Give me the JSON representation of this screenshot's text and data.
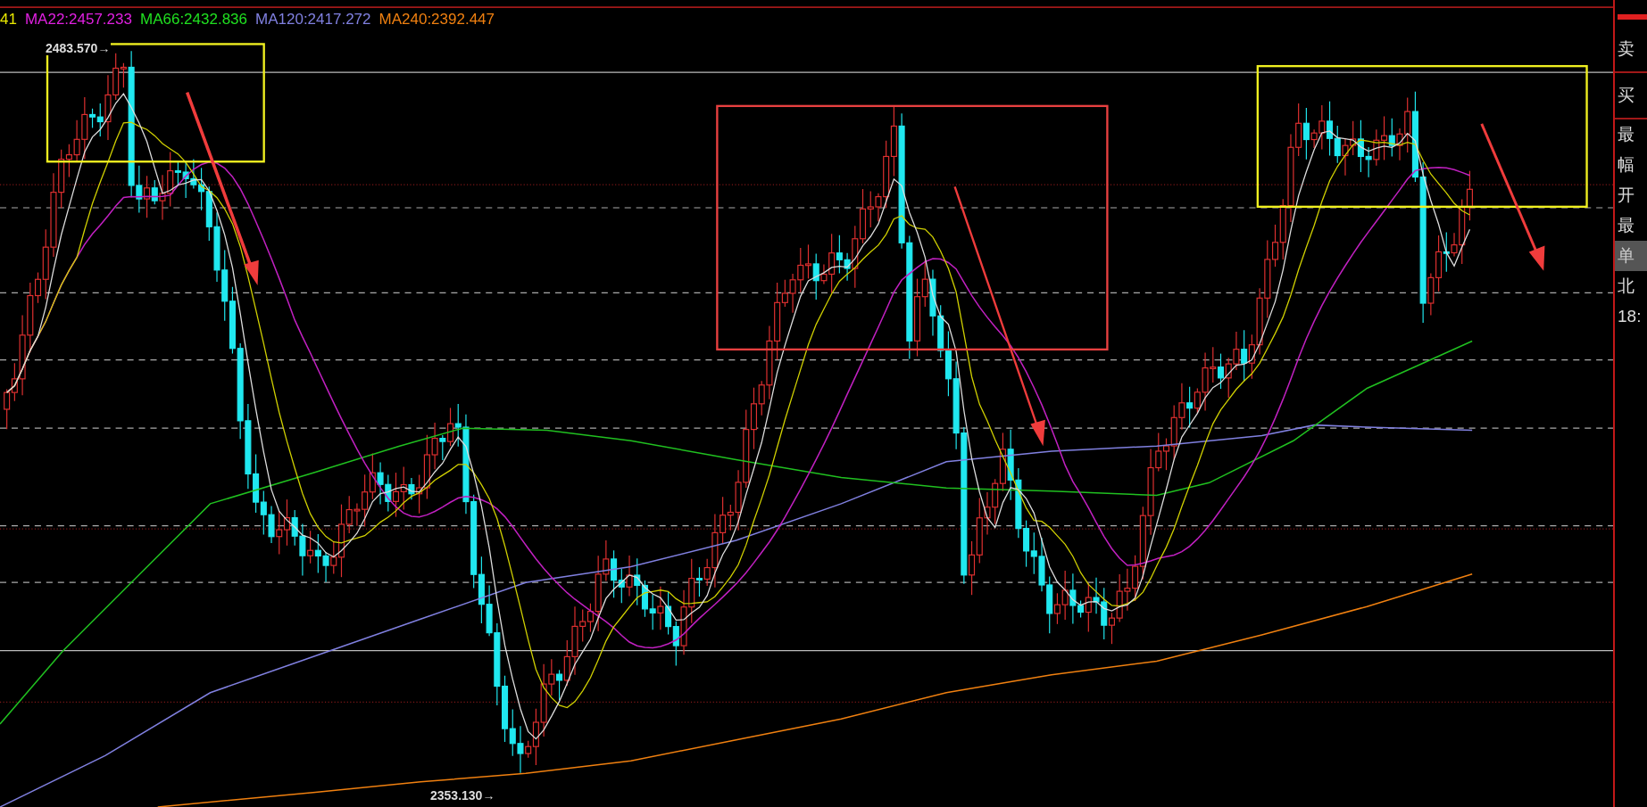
{
  "legend": [
    {
      "text": "41",
      "color": "#e8e800"
    },
    {
      "text": "MA22:2457.233",
      "color": "#e020e0"
    },
    {
      "text": "MA66:2432.836",
      "color": "#20e020"
    },
    {
      "text": "MA120:2417.272",
      "color": "#8080e0"
    },
    {
      "text": "MA240:2392.447",
      "color": "#f08010"
    }
  ],
  "high_label": "2483.570→",
  "low_label": "2353.130→",
  "side_panel": [
    {
      "label": "卖",
      "selected": false
    },
    {
      "label": "买",
      "selected": false
    },
    {
      "label": "最",
      "selected": false
    },
    {
      "label": "幅",
      "selected": false
    },
    {
      "label": "开",
      "selected": false
    },
    {
      "label": "最",
      "selected": false
    },
    {
      "label": "单",
      "selected": true
    },
    {
      "label": "北",
      "selected": false
    },
    {
      "label": "18:",
      "selected": false
    }
  ]
}
